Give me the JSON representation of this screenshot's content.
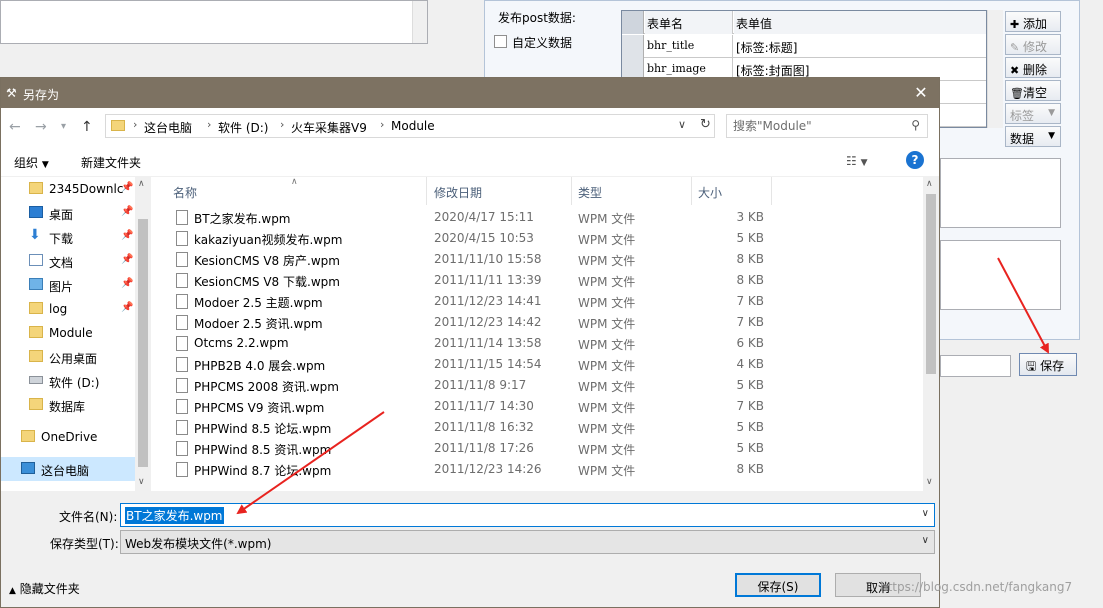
{
  "background_app": {
    "post_data_label": "发布post数据:",
    "custom_data_label": "自定义数据",
    "grid": {
      "headers": [
        "表单名",
        "表单值"
      ],
      "rows": [
        {
          "name": "bhr_title",
          "value": "[标签:标题]"
        },
        {
          "name": "bhr_image",
          "value": "[标签:封面图]"
        }
      ]
    },
    "side_buttons": {
      "add": "添加",
      "edit": "修改",
      "delete": "删除",
      "clear": "清空",
      "tag": "标签",
      "data": "数据"
    },
    "save_label": "保存"
  },
  "dialog": {
    "title": "另存为",
    "breadcrumbs": [
      "这台电脑",
      "软件 (D:)",
      "火车采集器V9",
      "Module"
    ],
    "search_placeholder": "搜索\"Module\"",
    "toolbar": {
      "organize": "组织",
      "new_folder": "新建文件夹"
    },
    "nav_items": [
      {
        "label": "2345Downlc",
        "icon": "folder-icon",
        "pinned": true
      },
      {
        "label": "桌面",
        "icon": "desktop-icon",
        "pinned": true
      },
      {
        "label": "下载",
        "icon": "download-icon",
        "pinned": true
      },
      {
        "label": "文档",
        "icon": "document-icon",
        "pinned": true
      },
      {
        "label": "图片",
        "icon": "picture-icon",
        "pinned": true
      },
      {
        "label": "log",
        "icon": "folder-icon",
        "pinned": true
      },
      {
        "label": "Module",
        "icon": "folder-icon",
        "pinned": false
      },
      {
        "label": "公用桌面",
        "icon": "folder-icon",
        "pinned": false
      },
      {
        "label": "软件 (D:)",
        "icon": "drive-icon",
        "pinned": false
      },
      {
        "label": "数据库",
        "icon": "folder-icon",
        "pinned": false
      },
      {
        "label": "OneDrive",
        "icon": "onedrive-icon",
        "pinned": false
      },
      {
        "label": "这台电脑",
        "icon": "this-pc-icon",
        "pinned": false
      }
    ],
    "columns": [
      "名称",
      "修改日期",
      "类型",
      "大小"
    ],
    "files": [
      {
        "name": "BT之家发布.wpm",
        "date": "2020/4/17 15:11",
        "type": "WPM 文件",
        "size": "3 KB"
      },
      {
        "name": "kakaziyuan视频发布.wpm",
        "date": "2020/4/15 10:53",
        "type": "WPM 文件",
        "size": "5 KB"
      },
      {
        "name": "KesionCMS V8 房产.wpm",
        "date": "2011/11/10 15:58",
        "type": "WPM 文件",
        "size": "8 KB"
      },
      {
        "name": "KesionCMS V8 下载.wpm",
        "date": "2011/11/11 13:39",
        "type": "WPM 文件",
        "size": "8 KB"
      },
      {
        "name": "Modoer 2.5 主题.wpm",
        "date": "2011/12/23 14:41",
        "type": "WPM 文件",
        "size": "7 KB"
      },
      {
        "name": "Modoer 2.5 资讯.wpm",
        "date": "2011/12/23 14:42",
        "type": "WPM 文件",
        "size": "7 KB"
      },
      {
        "name": "Otcms 2.2.wpm",
        "date": "2011/11/14 13:58",
        "type": "WPM 文件",
        "size": "6 KB"
      },
      {
        "name": "PHPB2B 4.0 展会.wpm",
        "date": "2011/11/15 14:54",
        "type": "WPM 文件",
        "size": "4 KB"
      },
      {
        "name": "PHPCMS 2008 资讯.wpm",
        "date": "2011/11/8 9:17",
        "type": "WPM 文件",
        "size": "5 KB"
      },
      {
        "name": "PHPCMS V9 资讯.wpm",
        "date": "2011/11/7 14:30",
        "type": "WPM 文件",
        "size": "7 KB"
      },
      {
        "name": "PHPWind 8.5 论坛.wpm",
        "date": "2011/11/8 16:32",
        "type": "WPM 文件",
        "size": "5 KB"
      },
      {
        "name": "PHPWind 8.5 资讯.wpm",
        "date": "2011/11/8 17:26",
        "type": "WPM 文件",
        "size": "5 KB"
      },
      {
        "name": "PHPWind 8.7 论坛.wpm",
        "date": "2011/12/23 14:26",
        "type": "WPM 文件",
        "size": "8 KB"
      }
    ],
    "filename_label": "文件名(N):",
    "filename_value": "BT之家发布.wpm",
    "filetype_label": "保存类型(T):",
    "filetype_value": "Web发布模块文件(*.wpm)",
    "hide_folders": "隐藏文件夹",
    "save_button": "保存(S)",
    "cancel_button": "取消"
  },
  "watermark": "https://blog.csdn.net/fangkang7",
  "colors": {
    "titlebar": "#7d7262",
    "accent": "#0078d7",
    "annotation_arrow": "#e8231f"
  }
}
